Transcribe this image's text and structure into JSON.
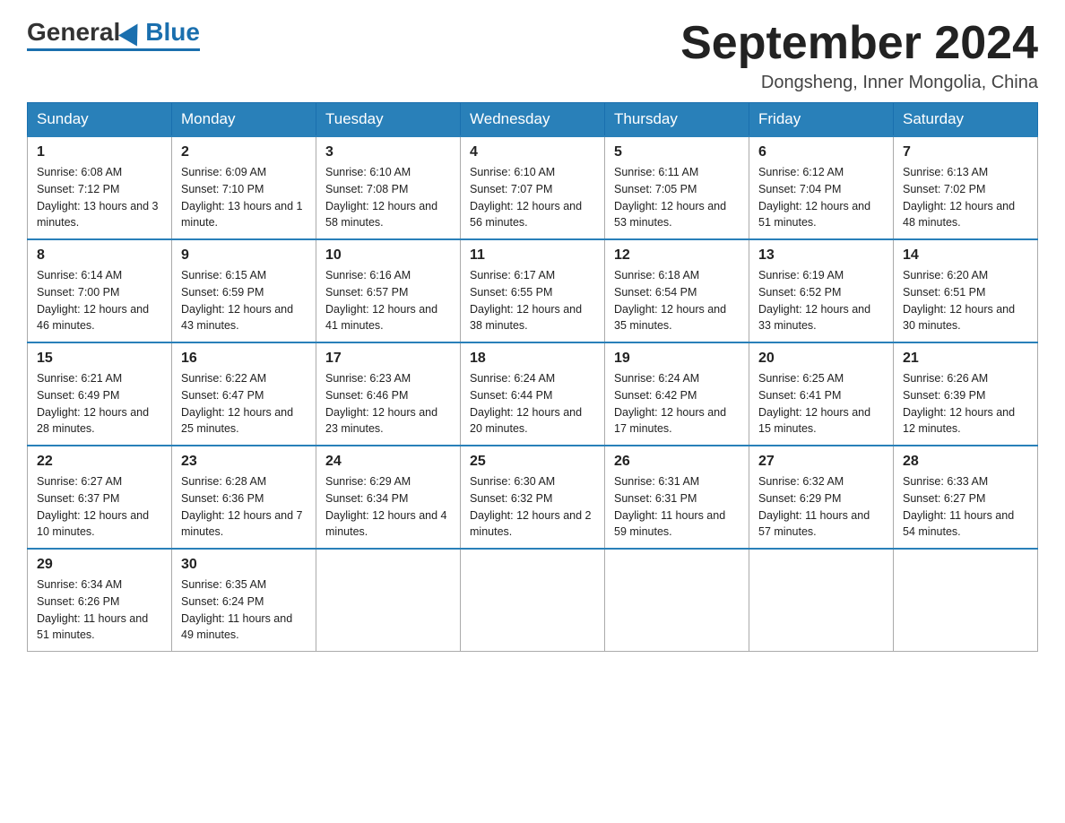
{
  "header": {
    "logo": {
      "part1": "General",
      "part2": "Blue"
    },
    "title": "September 2024",
    "location": "Dongsheng, Inner Mongolia, China"
  },
  "days_of_week": [
    "Sunday",
    "Monday",
    "Tuesday",
    "Wednesday",
    "Thursday",
    "Friday",
    "Saturday"
  ],
  "weeks": [
    [
      {
        "day": "1",
        "sunrise": "6:08 AM",
        "sunset": "7:12 PM",
        "daylight": "13 hours and 3 minutes."
      },
      {
        "day": "2",
        "sunrise": "6:09 AM",
        "sunset": "7:10 PM",
        "daylight": "13 hours and 1 minute."
      },
      {
        "day": "3",
        "sunrise": "6:10 AM",
        "sunset": "7:08 PM",
        "daylight": "12 hours and 58 minutes."
      },
      {
        "day": "4",
        "sunrise": "6:10 AM",
        "sunset": "7:07 PM",
        "daylight": "12 hours and 56 minutes."
      },
      {
        "day": "5",
        "sunrise": "6:11 AM",
        "sunset": "7:05 PM",
        "daylight": "12 hours and 53 minutes."
      },
      {
        "day": "6",
        "sunrise": "6:12 AM",
        "sunset": "7:04 PM",
        "daylight": "12 hours and 51 minutes."
      },
      {
        "day": "7",
        "sunrise": "6:13 AM",
        "sunset": "7:02 PM",
        "daylight": "12 hours and 48 minutes."
      }
    ],
    [
      {
        "day": "8",
        "sunrise": "6:14 AM",
        "sunset": "7:00 PM",
        "daylight": "12 hours and 46 minutes."
      },
      {
        "day": "9",
        "sunrise": "6:15 AM",
        "sunset": "6:59 PM",
        "daylight": "12 hours and 43 minutes."
      },
      {
        "day": "10",
        "sunrise": "6:16 AM",
        "sunset": "6:57 PM",
        "daylight": "12 hours and 41 minutes."
      },
      {
        "day": "11",
        "sunrise": "6:17 AM",
        "sunset": "6:55 PM",
        "daylight": "12 hours and 38 minutes."
      },
      {
        "day": "12",
        "sunrise": "6:18 AM",
        "sunset": "6:54 PM",
        "daylight": "12 hours and 35 minutes."
      },
      {
        "day": "13",
        "sunrise": "6:19 AM",
        "sunset": "6:52 PM",
        "daylight": "12 hours and 33 minutes."
      },
      {
        "day": "14",
        "sunrise": "6:20 AM",
        "sunset": "6:51 PM",
        "daylight": "12 hours and 30 minutes."
      }
    ],
    [
      {
        "day": "15",
        "sunrise": "6:21 AM",
        "sunset": "6:49 PM",
        "daylight": "12 hours and 28 minutes."
      },
      {
        "day": "16",
        "sunrise": "6:22 AM",
        "sunset": "6:47 PM",
        "daylight": "12 hours and 25 minutes."
      },
      {
        "day": "17",
        "sunrise": "6:23 AM",
        "sunset": "6:46 PM",
        "daylight": "12 hours and 23 minutes."
      },
      {
        "day": "18",
        "sunrise": "6:24 AM",
        "sunset": "6:44 PM",
        "daylight": "12 hours and 20 minutes."
      },
      {
        "day": "19",
        "sunrise": "6:24 AM",
        "sunset": "6:42 PM",
        "daylight": "12 hours and 17 minutes."
      },
      {
        "day": "20",
        "sunrise": "6:25 AM",
        "sunset": "6:41 PM",
        "daylight": "12 hours and 15 minutes."
      },
      {
        "day": "21",
        "sunrise": "6:26 AM",
        "sunset": "6:39 PM",
        "daylight": "12 hours and 12 minutes."
      }
    ],
    [
      {
        "day": "22",
        "sunrise": "6:27 AM",
        "sunset": "6:37 PM",
        "daylight": "12 hours and 10 minutes."
      },
      {
        "day": "23",
        "sunrise": "6:28 AM",
        "sunset": "6:36 PM",
        "daylight": "12 hours and 7 minutes."
      },
      {
        "day": "24",
        "sunrise": "6:29 AM",
        "sunset": "6:34 PM",
        "daylight": "12 hours and 4 minutes."
      },
      {
        "day": "25",
        "sunrise": "6:30 AM",
        "sunset": "6:32 PM",
        "daylight": "12 hours and 2 minutes."
      },
      {
        "day": "26",
        "sunrise": "6:31 AM",
        "sunset": "6:31 PM",
        "daylight": "11 hours and 59 minutes."
      },
      {
        "day": "27",
        "sunrise": "6:32 AM",
        "sunset": "6:29 PM",
        "daylight": "11 hours and 57 minutes."
      },
      {
        "day": "28",
        "sunrise": "6:33 AM",
        "sunset": "6:27 PM",
        "daylight": "11 hours and 54 minutes."
      }
    ],
    [
      {
        "day": "29",
        "sunrise": "6:34 AM",
        "sunset": "6:26 PM",
        "daylight": "11 hours and 51 minutes."
      },
      {
        "day": "30",
        "sunrise": "6:35 AM",
        "sunset": "6:24 PM",
        "daylight": "11 hours and 49 minutes."
      },
      null,
      null,
      null,
      null,
      null
    ]
  ]
}
